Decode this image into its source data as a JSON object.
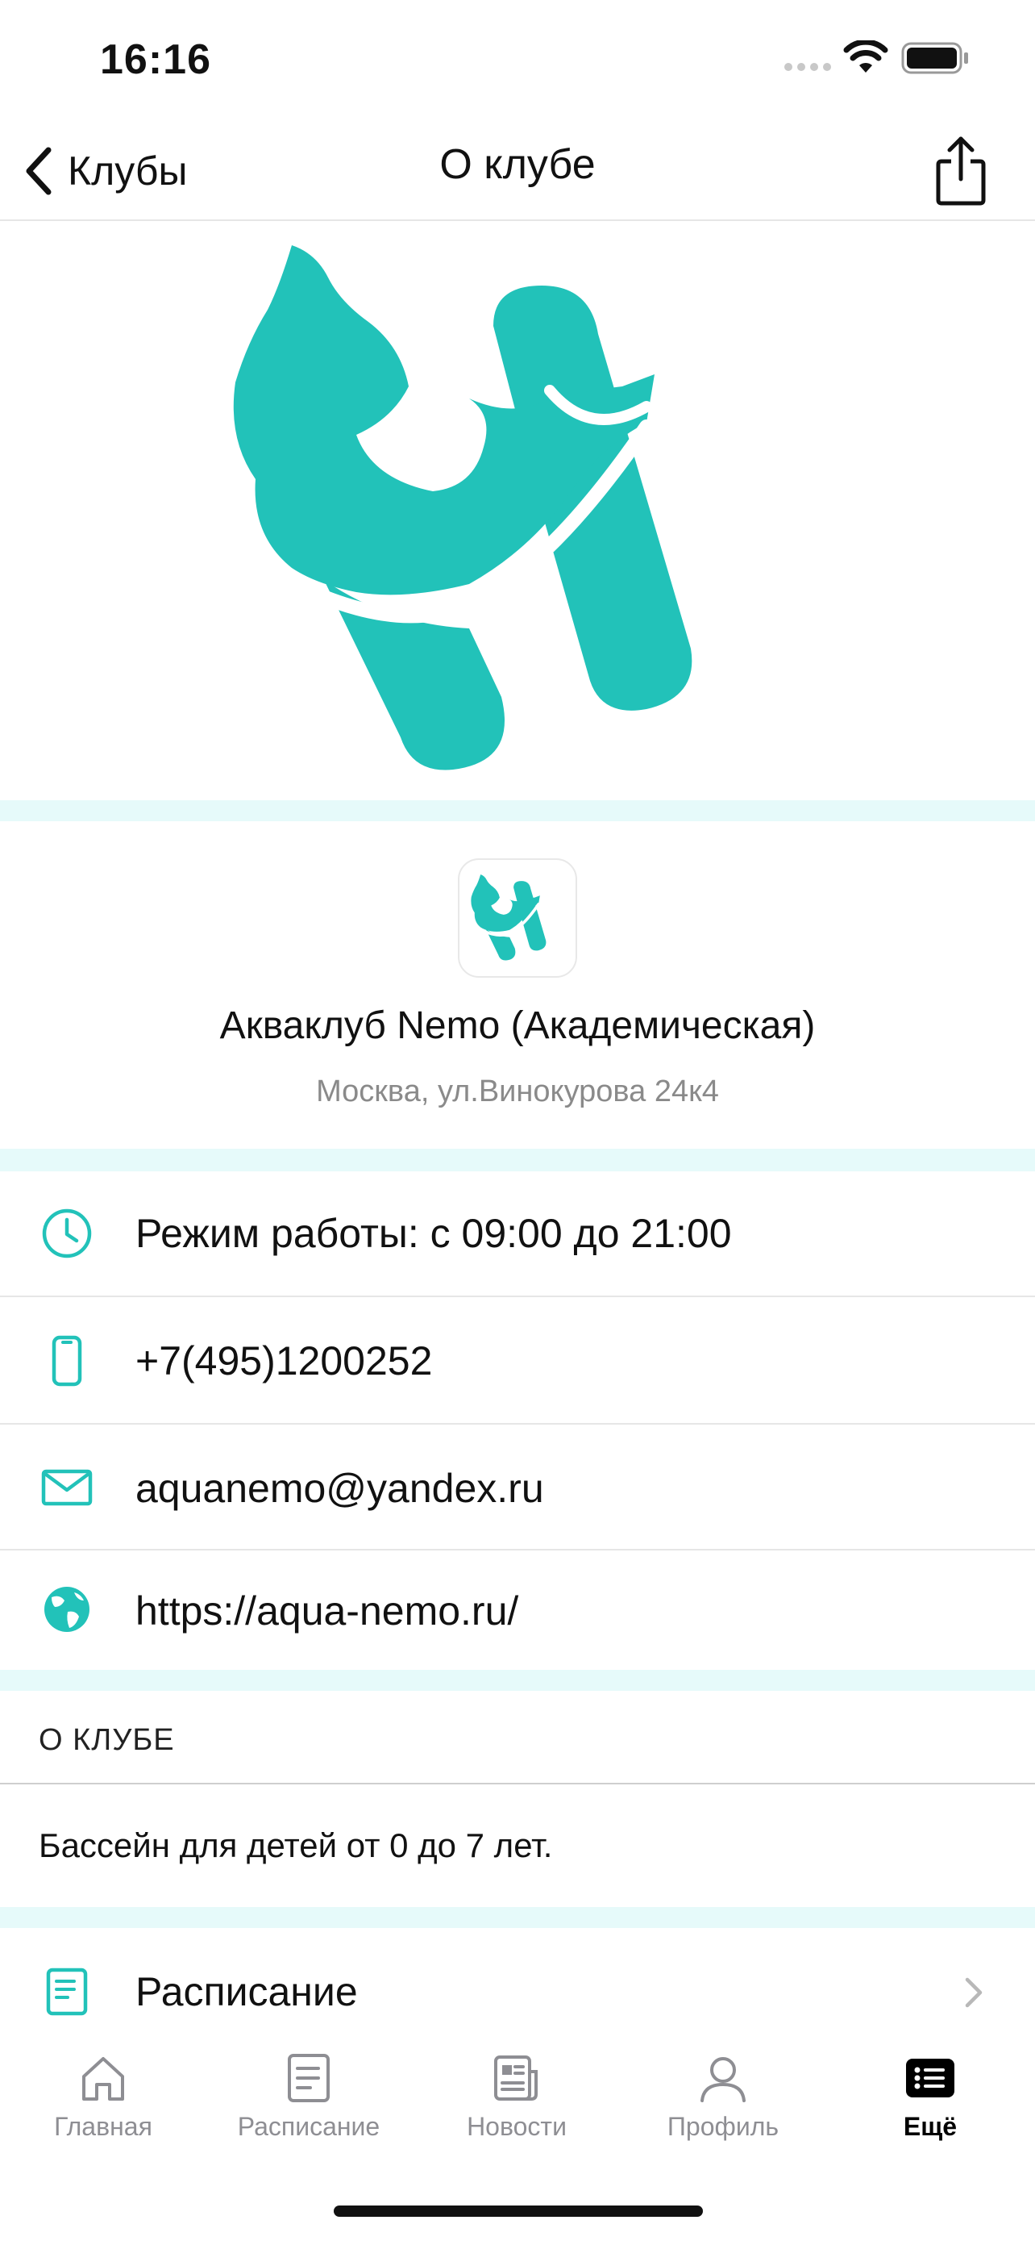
{
  "status_bar": {
    "time": "16:16"
  },
  "nav": {
    "back_label": "Клубы",
    "title": "О клубе"
  },
  "club": {
    "name": "Акваклуб Nemo (Академическая)",
    "address": "Москва, ул.Винокурова 24к4"
  },
  "info": {
    "hours": "Режим работы: с 09:00 до 21:00",
    "phone": "+7(495)1200252",
    "email": "aquanemo@yandex.ru",
    "website": "https://aqua-nemo.ru/"
  },
  "about": {
    "header": "О КЛУБЕ",
    "text": "Бассейн для детей от 0 до 7 лет."
  },
  "schedule": {
    "label": "Расписание"
  },
  "tabs": [
    {
      "label": "Главная",
      "icon": "home-icon"
    },
    {
      "label": "Расписание",
      "icon": "schedule-icon"
    },
    {
      "label": "Новости",
      "icon": "news-icon"
    },
    {
      "label": "Профиль",
      "icon": "profile-icon"
    },
    {
      "label": "Ещё",
      "icon": "more-icon",
      "active": true
    }
  ],
  "colors": {
    "accent": "#22c2b9",
    "separator": "#e6fafa",
    "inactive": "#8e8e93"
  }
}
